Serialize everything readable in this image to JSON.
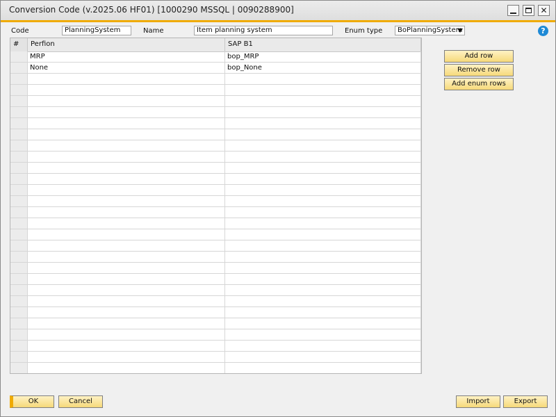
{
  "window": {
    "title": "Conversion Code (v.2025.06 HF01) [1000290 MSSQL | 0090288900]",
    "accent_color": "#f0ab00",
    "controls": [
      "minimize-icon",
      "maximize-icon",
      "close-icon"
    ]
  },
  "form": {
    "code_label": "Code",
    "code_value": "PlanningSystem",
    "name_label": "Name",
    "name_value": "Item planning system",
    "enum_type_label": "Enum type",
    "enum_type_value": "BoPlanningSystem",
    "help_icon": "question-circle-icon",
    "help_color": "#1e8ad6"
  },
  "grid": {
    "columns": [
      "#",
      "Perfion",
      "SAP B1"
    ],
    "rows": [
      {
        "num": "",
        "perfion": "MRP",
        "sap": "bop_MRP"
      },
      {
        "num": "",
        "perfion": "None",
        "sap": "bop_None"
      }
    ]
  },
  "actions": {
    "add_row": "Add row",
    "remove_row": "Remove row",
    "add_enum_rows": "Add enum rows"
  },
  "footer": {
    "ok": "OK",
    "cancel": "Cancel",
    "import": "Import",
    "export": "Export"
  }
}
